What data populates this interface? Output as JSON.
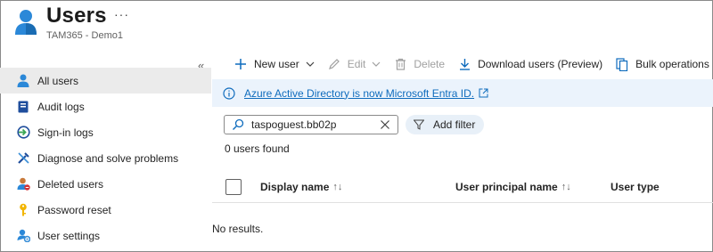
{
  "header": {
    "title": "Users",
    "more": "···",
    "subtitle": "TAM365 - Demo1"
  },
  "sidebar": {
    "collapse": "«",
    "items": [
      {
        "label": "All users",
        "icon": "user-icon",
        "active": true
      },
      {
        "label": "Audit logs",
        "icon": "book-icon",
        "active": false
      },
      {
        "label": "Sign-in logs",
        "icon": "sign-in-icon",
        "active": false
      },
      {
        "label": "Diagnose and solve problems",
        "icon": "wrench-icon",
        "active": false
      },
      {
        "label": "Deleted users",
        "icon": "deleted-user-icon",
        "active": false
      },
      {
        "label": "Password reset",
        "icon": "key-icon",
        "active": false
      },
      {
        "label": "User settings",
        "icon": "user-settings-icon",
        "active": false
      }
    ]
  },
  "toolbar": {
    "new_user": "New user",
    "edit": "Edit",
    "delete": "Delete",
    "download": "Download users (Preview)",
    "bulk": "Bulk operations"
  },
  "banner": {
    "link_text": "Azure Active Directory is now Microsoft Entra ID."
  },
  "search": {
    "value": "taspoguest.bb02p"
  },
  "filter": {
    "label": "Add filter"
  },
  "results": {
    "count_text": "0 users found",
    "empty_text": "No results."
  },
  "table": {
    "columns": [
      {
        "label": "Display name",
        "sort": "↑↓"
      },
      {
        "label": "User principal name",
        "sort": "↑↓"
      },
      {
        "label": "User type"
      }
    ]
  },
  "colors": {
    "accent": "#0f6cbd",
    "banner_bg": "#ebf3fc",
    "active_nav_bg": "#ebebeb"
  }
}
